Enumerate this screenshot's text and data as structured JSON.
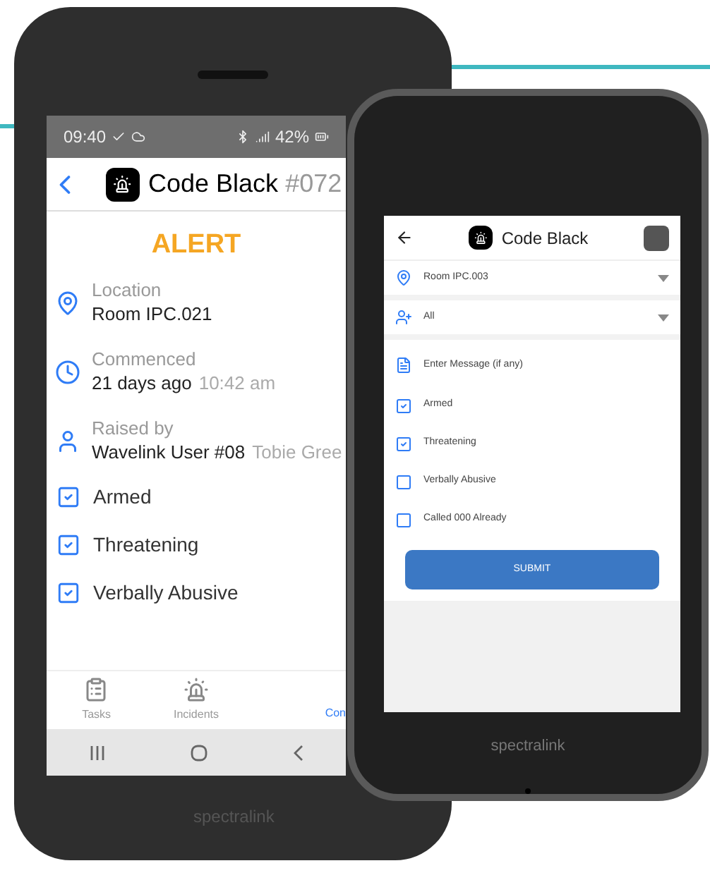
{
  "phone_left": {
    "status_bar": {
      "time": "09:40",
      "battery": "42%"
    },
    "header": {
      "title": "Code Black",
      "number": "#072"
    },
    "alert": "ALERT",
    "details": [
      {
        "kind": "location",
        "label": "Location",
        "value": "Room IPC.021"
      },
      {
        "kind": "time",
        "label": "Commenced",
        "value": "21 days ago",
        "extra": "10:42 am"
      },
      {
        "kind": "person",
        "label": "Raised by",
        "value": "Wavelink User #08",
        "extra": "Tobie Gree"
      }
    ],
    "flags": [
      {
        "label": "Armed",
        "checked": true
      },
      {
        "label": "Threatening",
        "checked": true
      },
      {
        "label": "Verbally Abusive",
        "checked": true
      }
    ],
    "nav": [
      {
        "kind": "tasks",
        "label": "Tasks",
        "selected": false
      },
      {
        "kind": "incidents",
        "label": "Incidents",
        "selected": false
      },
      {
        "label": "Con",
        "selected": true
      }
    ],
    "brand": "spectralink"
  },
  "phone_right": {
    "header": {
      "title": "Code Black"
    },
    "fields": [
      {
        "kind": "location",
        "value": "Room IPC.003"
      },
      {
        "kind": "recipients",
        "value": "All"
      },
      {
        "kind": "message",
        "placeholder": "Enter Message (if any)"
      }
    ],
    "flags": [
      {
        "label": "Armed",
        "checked": true
      },
      {
        "label": "Threatening",
        "checked": true
      },
      {
        "label": "Verbally Abusive",
        "checked": false
      },
      {
        "label": "Called 000 Already",
        "checked": false
      }
    ],
    "submit": "SUBMIT",
    "brand": "spectralink"
  }
}
